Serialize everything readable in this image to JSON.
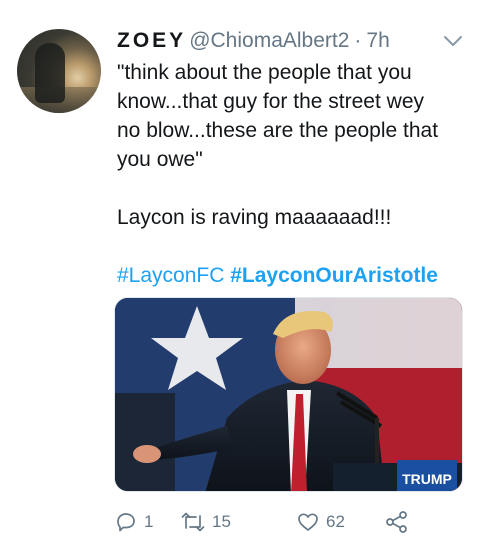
{
  "tweet": {
    "author": {
      "display_name": "ZOEY",
      "handle": "@ChiomaAlbert2",
      "separator": "·",
      "time": "7h"
    },
    "text_lines": [
      "\"think about the people that you",
      "know...that guy for the street wey",
      "no blow...these are the people that",
      "you owe\""
    ],
    "text_line2": "Laycon is raving maaaaaad!!!",
    "hashtags": [
      "#LayconFC",
      "#LayconOurAristotle"
    ],
    "media_sign_text": "TRUMP",
    "actions": {
      "reply_count": "1",
      "retweet_count": "15",
      "like_count": "62"
    },
    "icons": {
      "caret": "chevron-down-icon",
      "reply": "reply-icon",
      "retweet": "retweet-icon",
      "like": "heart-icon",
      "share": "share-icon"
    },
    "colors": {
      "link": "#1da1f2",
      "secondary": "#657786",
      "text": "#14171a"
    }
  }
}
